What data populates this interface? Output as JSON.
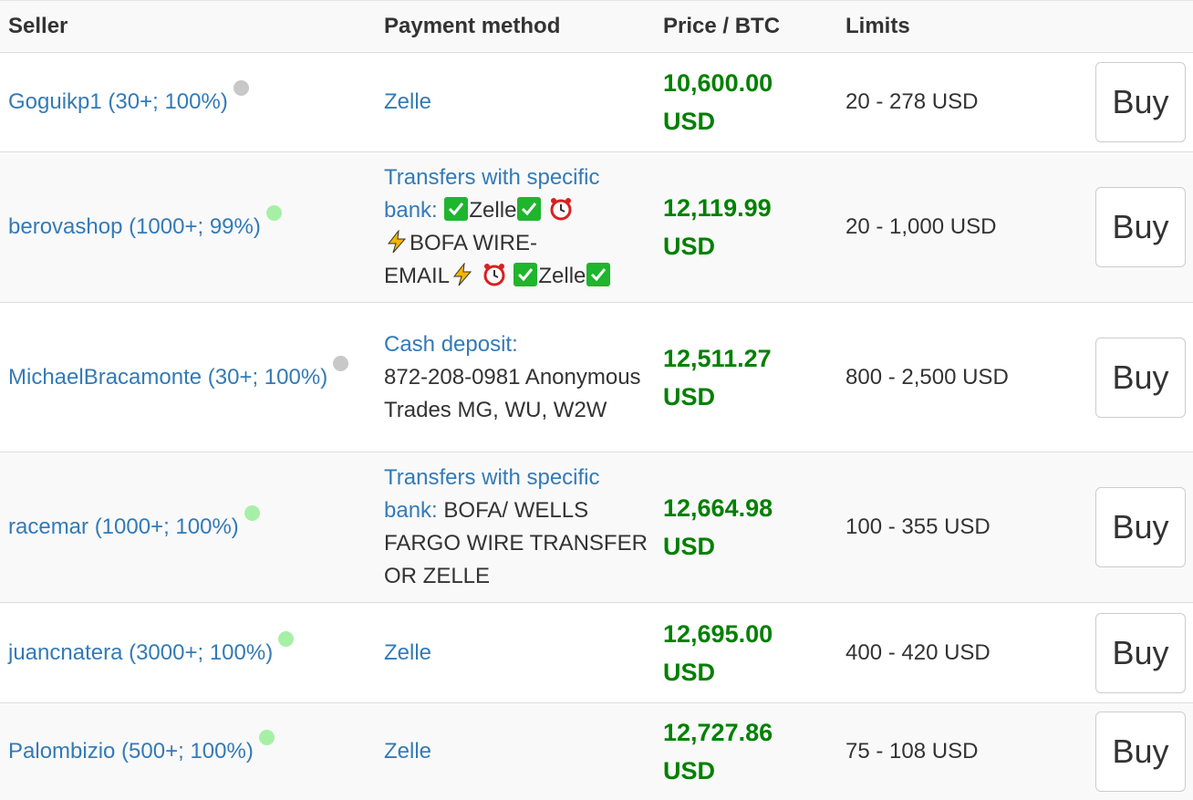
{
  "headers": {
    "seller": "Seller",
    "payment": "Payment method",
    "price": "Price / BTC",
    "limits": "Limits"
  },
  "status_colors": {
    "online": "#a6f0a6",
    "offline": "#c8c8c8"
  },
  "icons": {
    "check": "check-mark-icon",
    "alarm": "alarm-clock-icon",
    "bolt": "lightning-icon"
  },
  "rows": [
    {
      "seller": "Goguikp1 (30+; 100%)",
      "status": "offline",
      "payment_type": "Zelle",
      "payment_details": "",
      "price_line1": "10,600.00",
      "price_line2": "USD",
      "limits": "20 - 278 USD",
      "buy": "Buy"
    },
    {
      "seller": "berovashop (1000+; 99%)",
      "status": "online",
      "payment_type": "Transfers with specific bank:",
      "payment_words": {
        "zelle1": "Zelle",
        "bofa": "BOFA WIRE-",
        "email": "EMAIL",
        "zelle2": "Zelle"
      },
      "price_line1": "12,119.99",
      "price_line2": "USD",
      "limits": "20 - 1,000 USD",
      "buy": "Buy"
    },
    {
      "seller": "MichaelBracamonte (30+; 100%)",
      "status": "offline",
      "payment_type": "Cash deposit:",
      "payment_details": "872-208-0981 Anonymous Trades MG, WU, W2W",
      "price_line1": "12,511.27",
      "price_line2": "USD",
      "limits": "800 - 2,500 USD",
      "buy": "Buy"
    },
    {
      "seller": "racemar (1000+; 100%)",
      "status": "online",
      "payment_type": "Transfers with specific bank:",
      "payment_details": "BOFA/ WELLS FARGO WIRE TRANSFER OR ZELLE",
      "price_line1": "12,664.98",
      "price_line2": "USD",
      "limits": "100 - 355 USD",
      "buy": "Buy"
    },
    {
      "seller": "juancnatera (3000+; 100%)",
      "status": "online",
      "payment_type": "Zelle",
      "payment_details": "",
      "price_line1": "12,695.00",
      "price_line2": "USD",
      "limits": "400 - 420 USD",
      "buy": "Buy"
    },
    {
      "seller": "Palombizio (500+; 100%)",
      "status": "online",
      "payment_type": "Zelle",
      "payment_details": "",
      "price_line1": "12,727.86",
      "price_line2": "USD",
      "limits": "75 - 108 USD",
      "buy": "Buy"
    }
  ]
}
